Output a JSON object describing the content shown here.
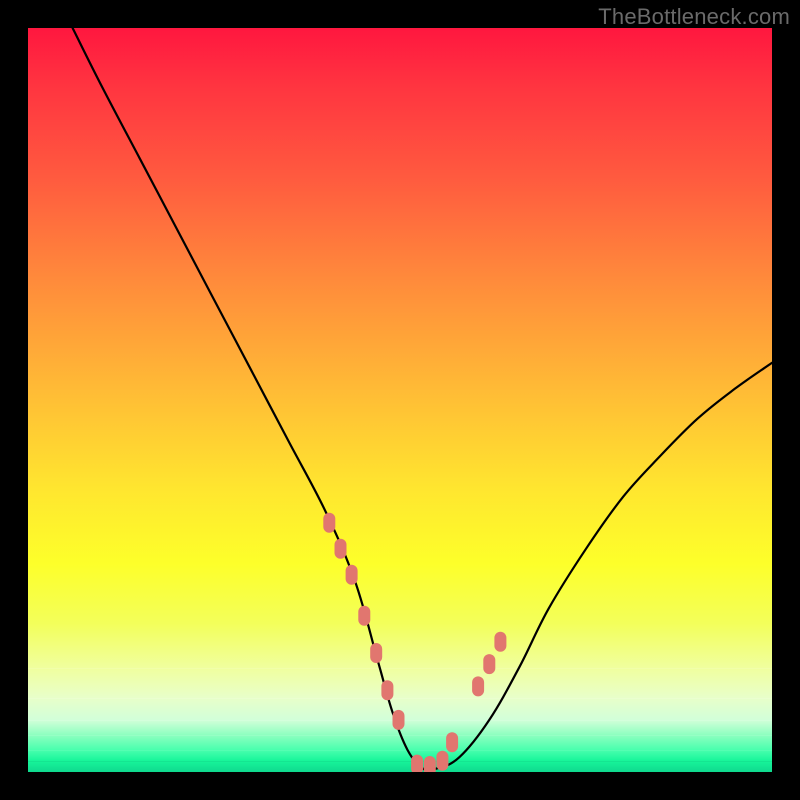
{
  "watermark": "TheBottleneck.com",
  "colors": {
    "frame": "#000000",
    "curve": "#000000",
    "marker": "#e1766f"
  },
  "chart_data": {
    "type": "line",
    "title": "",
    "xlabel": "",
    "ylabel": "",
    "xlim": [
      0,
      100
    ],
    "ylim": [
      0,
      100
    ],
    "series": [
      {
        "name": "bottleneck-curve",
        "x": [
          6,
          10,
          15,
          20,
          25,
          30,
          35,
          40,
          44,
          47,
          49,
          51,
          53,
          55,
          58,
          62,
          66,
          70,
          75,
          80,
          85,
          90,
          95,
          100
        ],
        "y": [
          100,
          92,
          82.5,
          73,
          63.5,
          54,
          44.5,
          35,
          25.5,
          15,
          8,
          3,
          0.5,
          0.5,
          2,
          7,
          14,
          22,
          30,
          37,
          42.5,
          47.5,
          51.5,
          55
        ]
      }
    ],
    "markers": {
      "name": "highlight-points",
      "x": [
        40.5,
        42.0,
        43.5,
        45.2,
        46.8,
        48.3,
        49.8,
        52.3,
        54.0,
        55.7,
        57.0,
        60.5,
        62.0,
        63.5
      ],
      "y": [
        33.5,
        30.0,
        26.5,
        21.0,
        16.0,
        11.0,
        7.0,
        1.0,
        0.8,
        1.5,
        4.0,
        11.5,
        14.5,
        17.5
      ]
    },
    "gradient_stops": [
      {
        "pos": 0,
        "color": "#ff173f"
      },
      {
        "pos": 0.62,
        "color": "#ffe62f"
      },
      {
        "pos": 0.86,
        "color": "#f0ff9e"
      },
      {
        "pos": 1.0,
        "color": "#0fd98e"
      }
    ]
  }
}
